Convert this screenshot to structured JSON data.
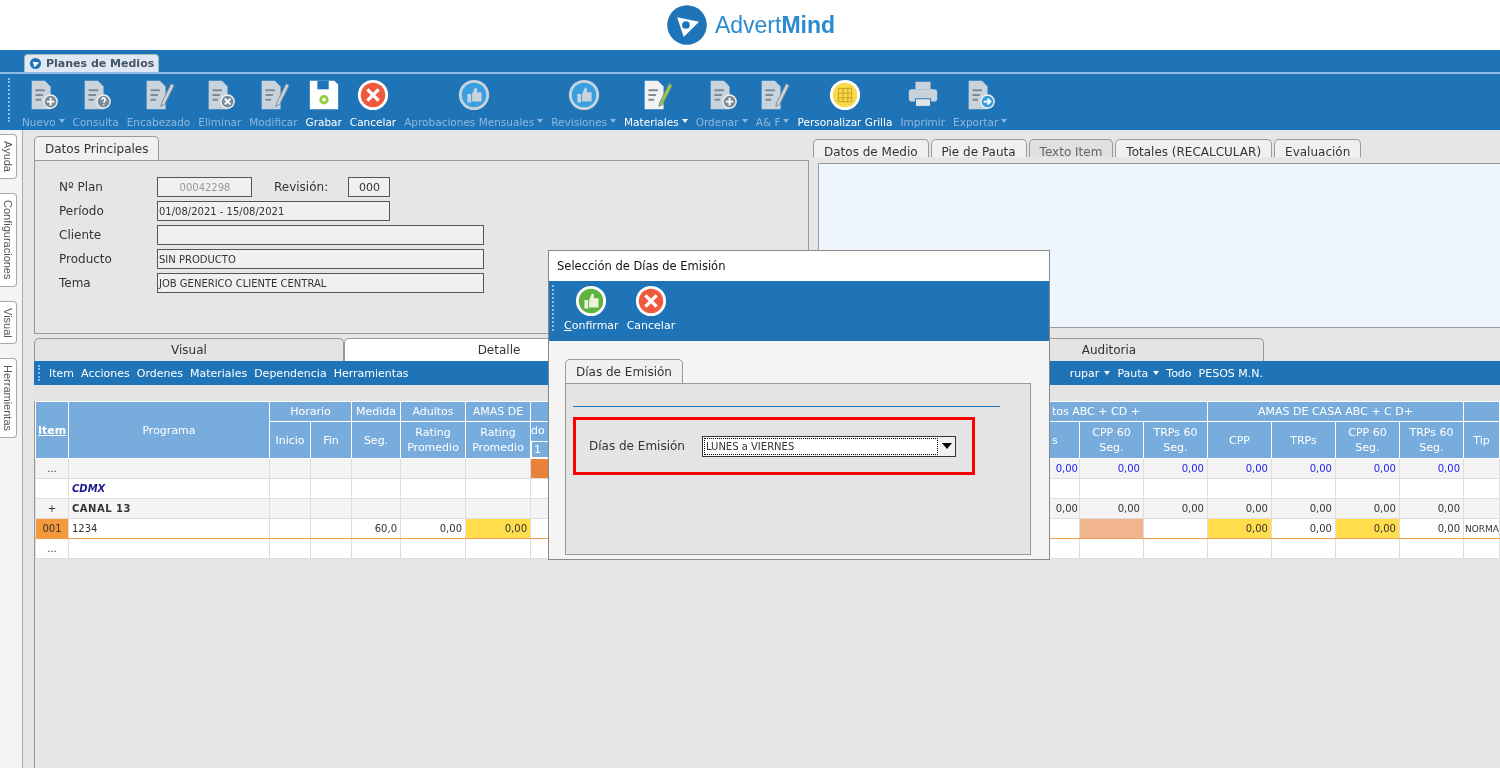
{
  "logo": {
    "text": "Advert**Mind**"
  },
  "app_tab": {
    "label": "Planes de Medios"
  },
  "toolbar": [
    {
      "label": "Nuevo",
      "kind": "doc-plus",
      "disabled": true,
      "dropdown": true
    },
    {
      "label": "Consulta",
      "kind": "doc-question",
      "disabled": true,
      "dropdown": false
    },
    {
      "label": "Encabezado",
      "kind": "doc-pencil",
      "disabled": true,
      "dropdown": false
    },
    {
      "label": "Eliminar",
      "kind": "doc-x",
      "disabled": true,
      "dropdown": false
    },
    {
      "label": "Modificar",
      "kind": "doc-pencil",
      "disabled": true,
      "dropdown": false
    },
    {
      "label": "Grabar",
      "kind": "save",
      "disabled": false,
      "dropdown": false
    },
    {
      "label": "Cancelar",
      "kind": "cancel",
      "disabled": false,
      "dropdown": false
    },
    {
      "label": "Aprobaciones Mensuales",
      "kind": "thumbs",
      "disabled": true,
      "dropdown": true
    },
    {
      "label": "Revisiones",
      "kind": "thumbs",
      "disabled": true,
      "dropdown": true
    },
    {
      "label": "Materiales",
      "kind": "doc-pencil-green",
      "disabled": false,
      "dropdown": true
    },
    {
      "label": "Ordenar",
      "kind": "doc-plus",
      "disabled": true,
      "dropdown": true
    },
    {
      "label": "A& F",
      "kind": "doc-pencil",
      "disabled": true,
      "dropdown": true
    },
    {
      "label": "Personalizar Grilla",
      "kind": "grid",
      "disabled": false,
      "dropdown": false
    },
    {
      "label": "Imprimir",
      "kind": "printer",
      "disabled": true,
      "dropdown": false
    },
    {
      "label": "Exportar",
      "kind": "doc-arrow",
      "disabled": true,
      "dropdown": true
    }
  ],
  "side_tabs": [
    "Ayuda",
    "Configuraciones",
    "Visual",
    "Herramientas"
  ],
  "main_panel": {
    "tab": "Datos Principales",
    "plan": {
      "label": "Nº Plan",
      "value": "00042298",
      "disabled": true
    },
    "revision": {
      "label": "Revisión:",
      "value": "000"
    },
    "fields": [
      {
        "label": "Período",
        "value": "01/08/2021 - 15/08/2021",
        "kind": "short"
      },
      {
        "label": "Cliente",
        "kind": "long"
      },
      {
        "label": "Producto",
        "value": "SIN PRODUCTO",
        "kind": "long"
      },
      {
        "label": "Tema",
        "value": "JOB GENERICO CLIENTE CENTRAL",
        "kind": "long"
      }
    ]
  },
  "side_panel": {
    "tabs": [
      {
        "label": "Datos de Medio",
        "selected": false
      },
      {
        "label": "Pie de Pauta",
        "selected": false
      },
      {
        "label": "Texto Item",
        "selected": true
      },
      {
        "label": "Totales (RECALCULAR)",
        "selected": false
      },
      {
        "label": "Evaluación",
        "selected": false
      }
    ]
  },
  "detail_tabs": [
    {
      "label": "Visual",
      "selected": false
    },
    {
      "label": "Detalle",
      "selected": true
    },
    {
      "label": "Auditoria",
      "selected": false
    }
  ],
  "grid_menu_left": [
    "Item",
    "Acciones",
    "Ordenes",
    "Materiales",
    "Dependencia",
    "Herramientas"
  ],
  "grid_menu_right": [
    {
      "label": "rupar",
      "dropdown": true
    },
    {
      "label": "Pauta",
      "dropdown": true
    },
    {
      "label": "Todo",
      "dropdown": false
    },
    {
      "label": "PESOS M.N.",
      "dropdown": false
    }
  ],
  "grid_left": {
    "groups": [
      "Horario",
      "Medida",
      "Adultos",
      "AMAS DE"
    ],
    "columns": [
      "Item",
      "Programa",
      "Inicio",
      "Fin",
      "Seg.",
      "Rating Promedio",
      "Rating Promedio",
      "do"
    ],
    "sub_label": "1",
    "rows": [
      {
        "kind": "summary",
        "cells": [
          "...",
          "",
          "",
          "",
          "",
          "",
          "",
          {
            "text": "",
            "color": "#e8813a"
          }
        ]
      },
      {
        "kind": "group",
        "cells": [
          "",
          "CDMX",
          "",
          "",
          "",
          "",
          "",
          ""
        ]
      },
      {
        "kind": "subgroup",
        "cells": [
          "+",
          "CANAL 13",
          "",
          "",
          "",
          "",
          "",
          ""
        ]
      },
      {
        "kind": "item",
        "cells": [
          {
            "text": "001",
            "color": "#f59a3a"
          },
          "1234",
          "",
          "",
          "60,0",
          "0,00",
          {
            "text": "0,00",
            "color": "#ffdd4d"
          },
          ""
        ]
      },
      {
        "kind": "empty",
        "cells": [
          "...",
          "",
          "",
          "",
          "",
          "",
          "",
          ""
        ]
      }
    ]
  },
  "grid_right": {
    "groups": [
      "tos ABC + CD +",
      "AMAS DE CASA ABC + C D+"
    ],
    "columns": [
      "s",
      "CPP 60 Seg.",
      "TRPs 60 Seg.",
      "CPP",
      "TRPs",
      "CPP 60 Seg.",
      "TRPs 60 Seg.",
      "Tip"
    ],
    "rows": [
      {
        "kind": "summary",
        "cells": [
          "0,00",
          "0,00",
          "0,00",
          "0,00",
          "0,00",
          "0,00",
          "0,00",
          ""
        ]
      },
      {
        "kind": "group",
        "cells": [
          "",
          "",
          "",
          "",
          "",
          "",
          "",
          ""
        ]
      },
      {
        "kind": "subgroup",
        "cells": [
          "0,00",
          "0,00",
          "0,00",
          "0,00",
          "0,00",
          "0,00",
          "0,00",
          ""
        ]
      },
      {
        "kind": "item",
        "cells": [
          "",
          {
            "text": "",
            "color": "#f0b48e"
          },
          "",
          {
            "text": "0,00",
            "color": "#ffdd4d"
          },
          "0,00",
          {
            "text": "0,00",
            "color": "#ffdd4d"
          },
          "0,00",
          "NORMA"
        ]
      },
      {
        "kind": "empty",
        "cells": [
          "",
          "",
          "",
          "",
          "",
          "",
          "",
          ""
        ]
      }
    ]
  },
  "dialog": {
    "title": "Selección de Días de Emisión",
    "buttons": [
      {
        "label": "Confirmar",
        "kind": "confirm"
      },
      {
        "label": "Cancelar",
        "kind": "cancel"
      }
    ],
    "tab": "Días de Emisión",
    "field": {
      "label": "Días de Emisión",
      "value": "LUNES a VIERNES"
    }
  }
}
